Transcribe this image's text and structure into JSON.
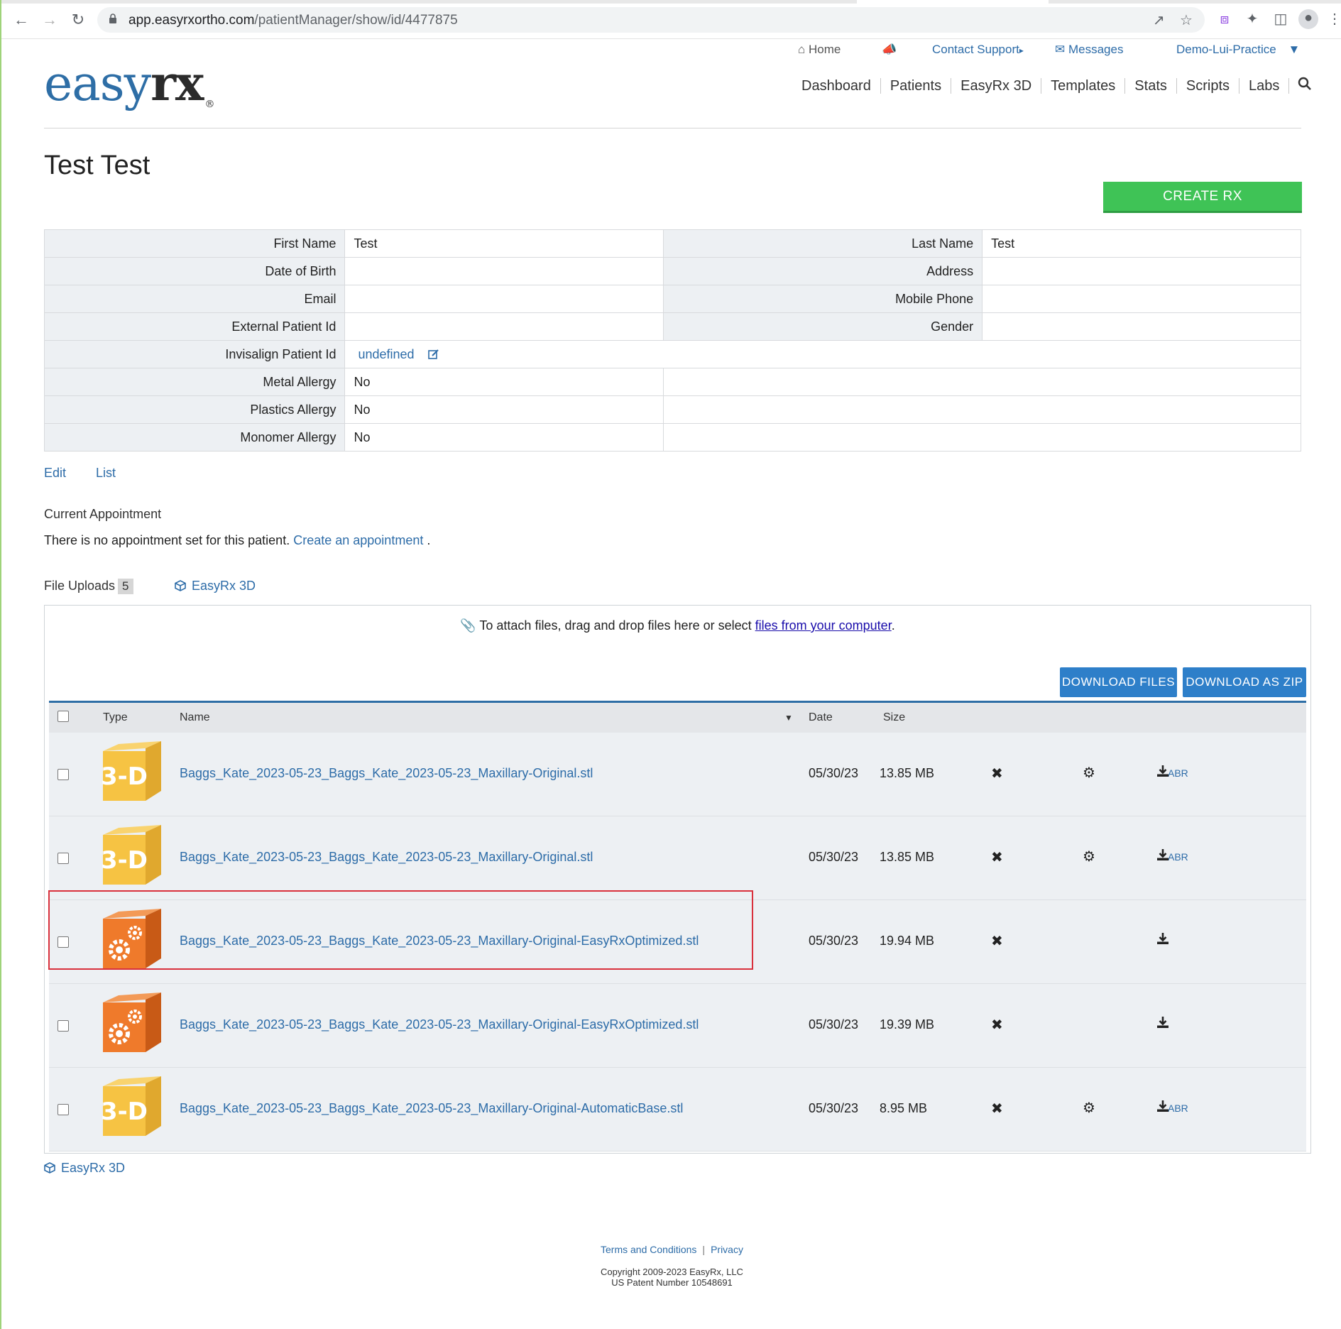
{
  "browser": {
    "url_host": "app.easyrxortho.com",
    "url_path": "/patientManager/show/id/4477875"
  },
  "topnav": {
    "home": "Home",
    "contact_support": "Contact Support",
    "messages": "Messages",
    "practice": "Demo-Lui-Practice"
  },
  "logo": {
    "easy": "easy",
    "rx": "rx",
    "reg": "®"
  },
  "mainnav": [
    "Dashboard",
    "Patients",
    "EasyRx 3D",
    "Templates",
    "Stats",
    "Scripts",
    "Labs"
  ],
  "patient": {
    "title": "Test Test",
    "create_rx": "CREATE RX",
    "fields": {
      "first_name_label": "First Name",
      "first_name": "Test",
      "last_name_label": "Last Name",
      "last_name": "Test",
      "dob_label": "Date of Birth",
      "address_label": "Address",
      "email_label": "Email",
      "mobile_label": "Mobile Phone",
      "external_id_label": "External Patient Id",
      "gender_label": "Gender",
      "invisalign_label": "Invisalign Patient Id",
      "invisalign_value": "undefined",
      "metal_label": "Metal Allergy",
      "metal_value": "No",
      "plastics_label": "Plastics Allergy",
      "plastics_value": "No",
      "monomer_label": "Monomer Allergy",
      "monomer_value": "No"
    },
    "edit_link": "Edit",
    "list_link": "List"
  },
  "appointment": {
    "heading": "Current Appointment",
    "text": "There is no appointment set for this patient.",
    "link": "Create an appointment",
    "end": "."
  },
  "uploads": {
    "label": "File Uploads",
    "count": "5",
    "easyrx3d": "EasyRx 3D",
    "attach_text": "To attach files, drag and drop files here or select",
    "attach_link": "files from your computer",
    "download_files": "DOWNLOAD FILES",
    "download_zip": "DOWNLOAD AS ZIP",
    "columns": {
      "type": "Type",
      "name": "Name",
      "date": "Date",
      "size": "Size"
    },
    "files": [
      {
        "type": "3d",
        "name": "Baggs_Kate_2023-05-23_Baggs_Kate_2023-05-23_Maxillary-Original.stl",
        "date": "05/30/23",
        "size": "13.85 MB",
        "abr": "ABR"
      },
      {
        "type": "3d",
        "name": "Baggs_Kate_2023-05-23_Baggs_Kate_2023-05-23_Maxillary-Original.stl",
        "date": "05/30/23",
        "size": "13.85 MB",
        "abr": "ABR"
      },
      {
        "type": "optimized",
        "name": "Baggs_Kate_2023-05-23_Baggs_Kate_2023-05-23_Maxillary-Original-EasyRxOptimized.stl",
        "date": "05/30/23",
        "size": "19.94 MB",
        "abr": ""
      },
      {
        "type": "optimized",
        "name": "Baggs_Kate_2023-05-23_Baggs_Kate_2023-05-23_Maxillary-Original-EasyRxOptimized.stl",
        "date": "05/30/23",
        "size": "19.39 MB",
        "abr": ""
      },
      {
        "type": "3d",
        "name": "Baggs_Kate_2023-05-23_Baggs_Kate_2023-05-23_Maxillary-Original-AutomaticBase.stl",
        "date": "05/30/23",
        "size": "8.95 MB",
        "abr": "ABR"
      }
    ],
    "bottom_link": "EasyRx 3D"
  },
  "footer": {
    "terms": "Terms and Conditions",
    "privacy": "Privacy",
    "copyright": "Copyright 2009-2023 EasyRx, LLC",
    "patent": "US Patent Number 10548691"
  },
  "colors": {
    "brand_blue": "#2e6ea6",
    "create_green": "#3fc356",
    "button_blue": "#2e7fc9",
    "highlight_red": "#d9303c",
    "cube_yellow": "#f6c343",
    "cube_orange": "#ef7a2b"
  }
}
